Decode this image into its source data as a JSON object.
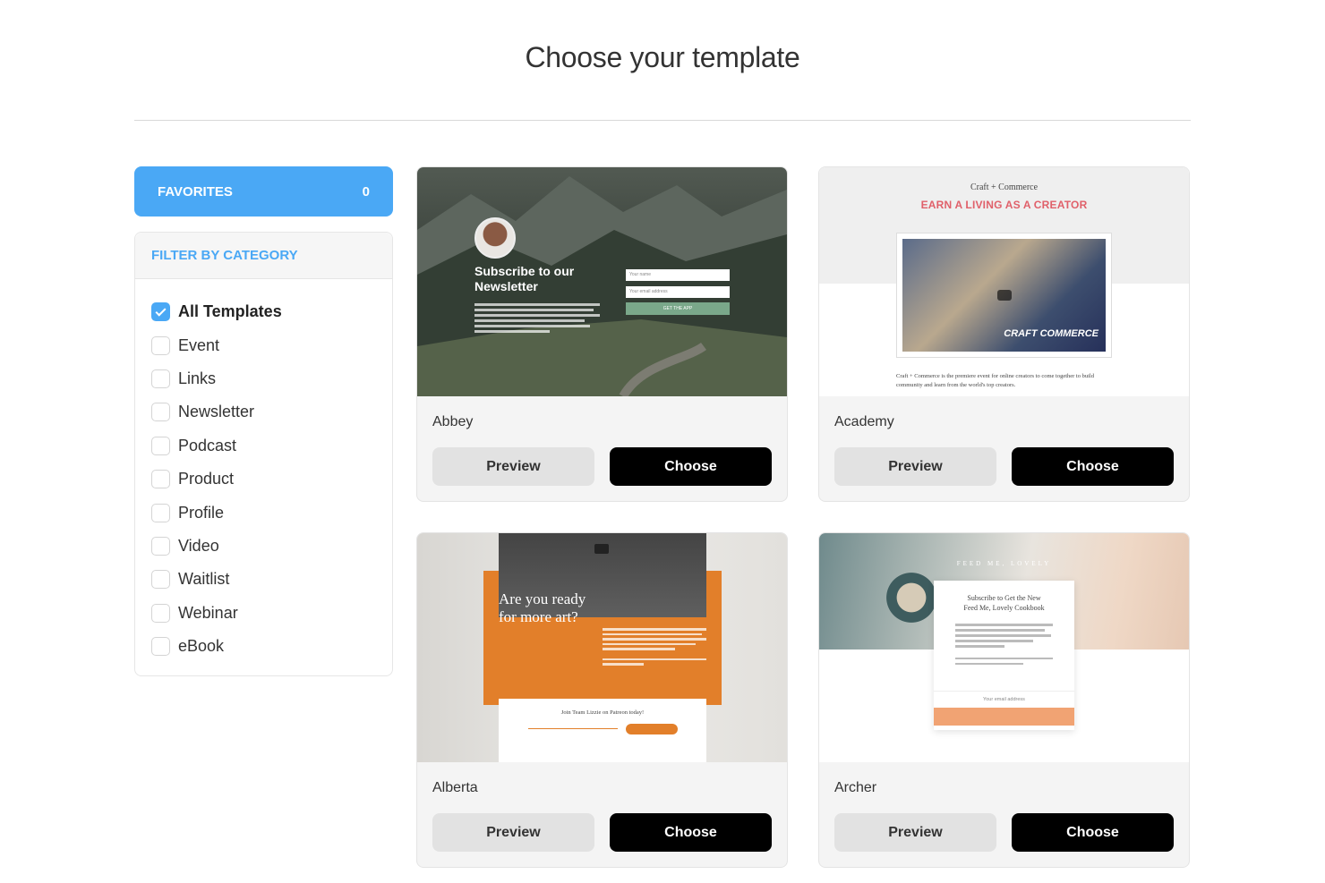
{
  "page": {
    "title": "Choose your template"
  },
  "sidebar": {
    "favorites": {
      "label": "FAVORITES",
      "count": "0"
    },
    "filter": {
      "heading": "FILTER BY CATEGORY",
      "categories": [
        {
          "label": "All Templates",
          "checked": true
        },
        {
          "label": "Event",
          "checked": false
        },
        {
          "label": "Links",
          "checked": false
        },
        {
          "label": "Newsletter",
          "checked": false
        },
        {
          "label": "Podcast",
          "checked": false
        },
        {
          "label": "Product",
          "checked": false
        },
        {
          "label": "Profile",
          "checked": false
        },
        {
          "label": "Video",
          "checked": false
        },
        {
          "label": "Waitlist",
          "checked": false
        },
        {
          "label": "Webinar",
          "checked": false
        },
        {
          "label": "eBook",
          "checked": false
        }
      ]
    }
  },
  "templates": [
    {
      "name": "Abbey",
      "preview_label": "Preview",
      "choose_label": "Choose",
      "thumb": {
        "title": "Subscribe to our Newsletter",
        "field_name": "Your name",
        "field_email": "Your email address",
        "button": "GET THE APP"
      }
    },
    {
      "name": "Academy",
      "preview_label": "Preview",
      "choose_label": "Choose",
      "thumb": {
        "sup": "Craft + Commerce",
        "headline": "EARN A LIVING AS A CREATOR",
        "brand": "CRAFT COMMERCE",
        "text": "Craft + Commerce is the premiere event for online creators to come together to build community and learn from the world's top creators."
      }
    },
    {
      "name": "Alberta",
      "preview_label": "Preview",
      "choose_label": "Choose",
      "thumb": {
        "heading": "Are you ready for more art?",
        "form_title": "Join Team Lizzie on Patreon today!"
      }
    },
    {
      "name": "Archer",
      "preview_label": "Preview",
      "choose_label": "Choose",
      "thumb": {
        "brand": "FEED ME, LOVELY",
        "card_title_a": "Subscribe to Get the New",
        "card_title_b": "Feed Me, Lovely Cookbook",
        "field": "Your email address"
      }
    }
  ],
  "colors": {
    "accent": "#4aa8f5",
    "choose_bg": "#000000",
    "preview_bg": "#e2e2e2"
  }
}
